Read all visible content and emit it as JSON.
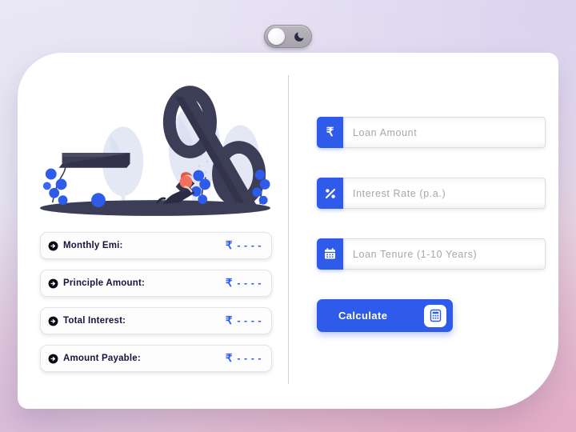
{
  "theme_toggle": {
    "name": "dark-mode-toggle",
    "state": "light",
    "moon_icon": "moon-icon",
    "knob_icon": "toggle-knob"
  },
  "illustration": {
    "name": "percent-illustration",
    "alt": "Large percent symbol with bench, trees, berry bushes and a seated person",
    "symbol": "%",
    "colors": {
      "percent": "#3c3d56",
      "ground": "#3c3d56",
      "tree": "#e4e8f5",
      "berry": "#2f5bea",
      "hair": "#f2705e"
    }
  },
  "results": {
    "title": "results",
    "rows": [
      {
        "label": "Monthly Emi:",
        "currency": "₹",
        "value": "- - - -",
        "icon": "arrow-circle-icon"
      },
      {
        "label": "Principle Amount:",
        "currency": "₹",
        "value": "- - - -",
        "icon": "arrow-circle-icon"
      },
      {
        "label": "Total Interest:",
        "currency": "₹",
        "value": "- - - -",
        "icon": "arrow-circle-icon"
      },
      {
        "label": "Amount Payable:",
        "currency": "₹",
        "value": "- - - -",
        "icon": "arrow-circle-icon"
      }
    ]
  },
  "form": {
    "fields": [
      {
        "name": "loan-amount",
        "placeholder": "Loan Amount",
        "value": "",
        "icon": "rupee-icon",
        "glyph": "₹"
      },
      {
        "name": "interest-rate",
        "placeholder": "Interest Rate (p.a.)",
        "value": "",
        "icon": "percent-icon",
        "glyph": "%"
      },
      {
        "name": "loan-tenure",
        "placeholder": "Loan Tenure (1-10 Years)",
        "value": "",
        "icon": "calendar-icon",
        "glyph": ""
      }
    ],
    "submit": {
      "label": "Calculate",
      "icon": "calculator-icon"
    }
  },
  "colors": {
    "accent": "#2f5bea",
    "text_dark": "#14143c",
    "placeholder": "#a6a6ae",
    "card": "#ffffff",
    "divider": "#cfcfd6"
  }
}
